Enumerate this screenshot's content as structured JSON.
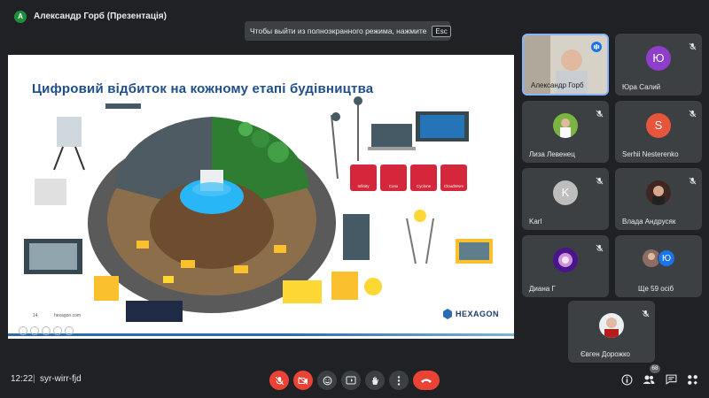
{
  "header": {
    "presenter_initial": "A",
    "presenter_label": "Александр Горб (Презентація)"
  },
  "fullscreen_hint": {
    "text": "Чтобы выйти из полноэкранного режима, нажмите",
    "key": "Esc"
  },
  "slide": {
    "title": "Цифровий відбиток на кожному етапі будівництва",
    "page": "14",
    "site": "hexagon.com",
    "brand": "HEXAGON",
    "products": [
      {
        "label": "Infinity"
      },
      {
        "label": "Conx"
      },
      {
        "label": "Cyclone"
      },
      {
        "label": "CloudWorx"
      }
    ]
  },
  "participants": [
    {
      "name": "Александр Горб",
      "type": "video",
      "speaking": true
    },
    {
      "name": "Юра Салий",
      "initial": "Ю",
      "color": "#8e3ec9"
    },
    {
      "name": "Лиза Левенец",
      "type": "photo"
    },
    {
      "name": "Serhii Nesterenko",
      "initial": "S",
      "color": "#e8553d"
    },
    {
      "name": "Karl",
      "initial": "K",
      "color": "#bdbdbd"
    },
    {
      "name": "Влада Андрусяк",
      "type": "photo"
    },
    {
      "name": "Диана Г",
      "type": "photo"
    },
    {
      "name": "Ще 59 осіб",
      "type": "group",
      "second_initial": "Ю"
    },
    {
      "name": "Євген Дорожко",
      "type": "photo"
    }
  ],
  "bottom_bar": {
    "time": "12:22",
    "separator": "|",
    "meeting_code": "syr-wirr-fjd",
    "participant_count": "68"
  },
  "colors": {
    "background": "#202124",
    "tile": "#3c4043",
    "danger": "#ea4335",
    "slide_title": "#1f4e8c"
  }
}
